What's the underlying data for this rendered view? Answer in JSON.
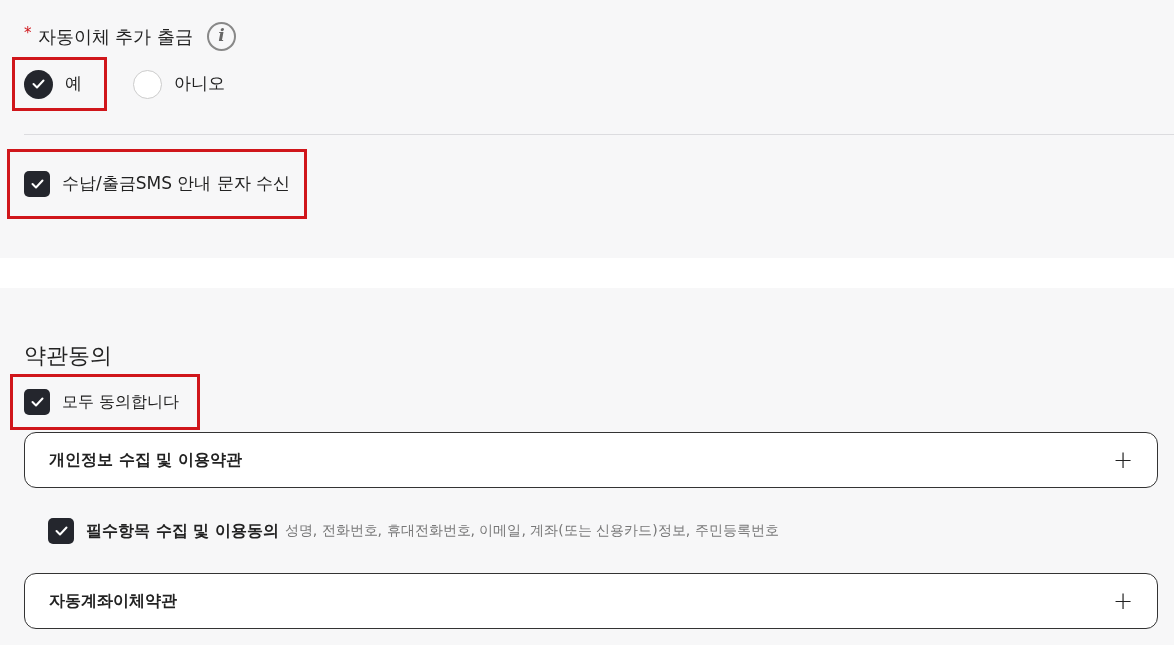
{
  "auto_withdrawal": {
    "required_mark": "*",
    "label": "자동이체 추가 출금",
    "info_icon": "i",
    "options": [
      {
        "label": "예",
        "selected": true,
        "highlighted": true
      },
      {
        "label": "아니오",
        "selected": false,
        "highlighted": false
      }
    ]
  },
  "sms_notice": {
    "label": "수납/출금SMS 안내 문자 수신",
    "checked": true,
    "highlighted": true
  },
  "terms": {
    "title": "약관동의",
    "agree_all": {
      "label": "모두 동의합니다",
      "checked": true,
      "highlighted": true
    },
    "sections": [
      {
        "title": "개인정보 수집 및 이용약관",
        "expand_icon": "+",
        "items": [
          {
            "label": "필수항목 수집 및 이용동의",
            "detail": "성명, 전화번호, 휴대전화번호, 이메일, 계좌(또는 신용카드)정보, 주민등록번호",
            "checked": true
          }
        ]
      },
      {
        "title": "자동계좌이체약관",
        "expand_icon": "+"
      }
    ]
  }
}
